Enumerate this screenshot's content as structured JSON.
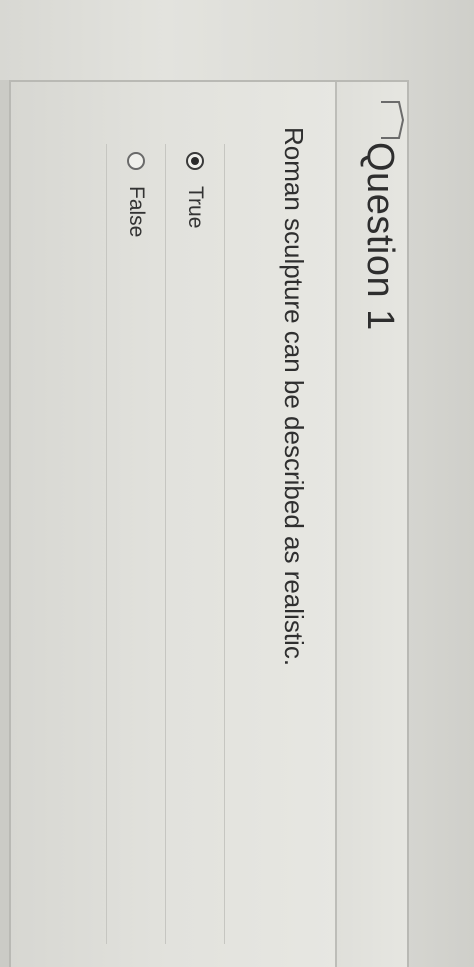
{
  "question": {
    "title": "Question 1",
    "text": "Roman sculpture can be described as realistic.",
    "answers": [
      {
        "label": "True",
        "selected": true
      },
      {
        "label": "False",
        "selected": false
      }
    ]
  },
  "icons": {
    "flag": "flag-icon",
    "radio_selected": "radio-selected-icon",
    "radio_unselected": "radio-unselected-icon"
  },
  "colors": {
    "text": "#2e2e2e",
    "border": "#b9b9b4",
    "background": "#e3e3de"
  }
}
